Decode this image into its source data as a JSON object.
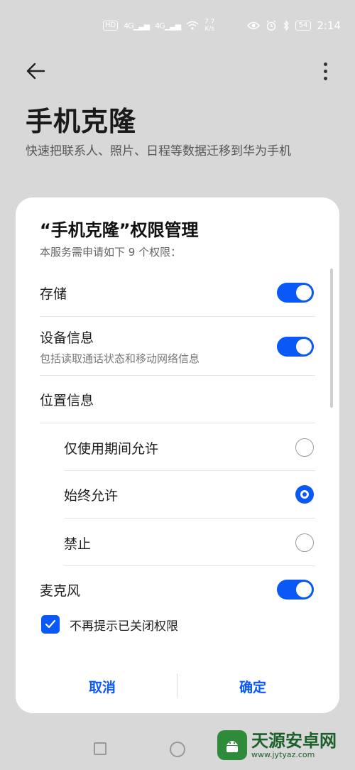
{
  "status_bar": {
    "hd_badge": "HD",
    "network_1": "4G",
    "network_2": "4G",
    "speed_value": "7.7",
    "speed_unit": "K/s",
    "battery": "54",
    "time": "2:14"
  },
  "header": {
    "title": "手机克隆",
    "subtitle": "快速把联系人、照片、日程等数据迁移到华为手机"
  },
  "dialog": {
    "title": "“手机克隆”权限管理",
    "description": "本服务需申请如下 9 个权限：",
    "permissions": [
      {
        "label": "存储",
        "enabled": true
      },
      {
        "label": "设备信息",
        "sublabel": "包括读取通话状态和移动网络信息",
        "enabled": true
      },
      {
        "label": "位置信息"
      },
      {
        "label": "麦克风",
        "enabled": true
      }
    ],
    "location_options": [
      {
        "label": "仅使用期间允许",
        "selected": false
      },
      {
        "label": "始终允许",
        "selected": true
      },
      {
        "label": "禁止",
        "selected": false
      }
    ],
    "dont_remind_label": "不再提示已关闭权限",
    "dont_remind_checked": true,
    "cancel_label": "取消",
    "confirm_label": "确定"
  },
  "watermark": {
    "name": "天源安卓网",
    "url": "www.jytyaz.com"
  },
  "colors": {
    "accent": "#0a59f7",
    "background": "#d8d8d8",
    "dialog": "#ffffff"
  }
}
